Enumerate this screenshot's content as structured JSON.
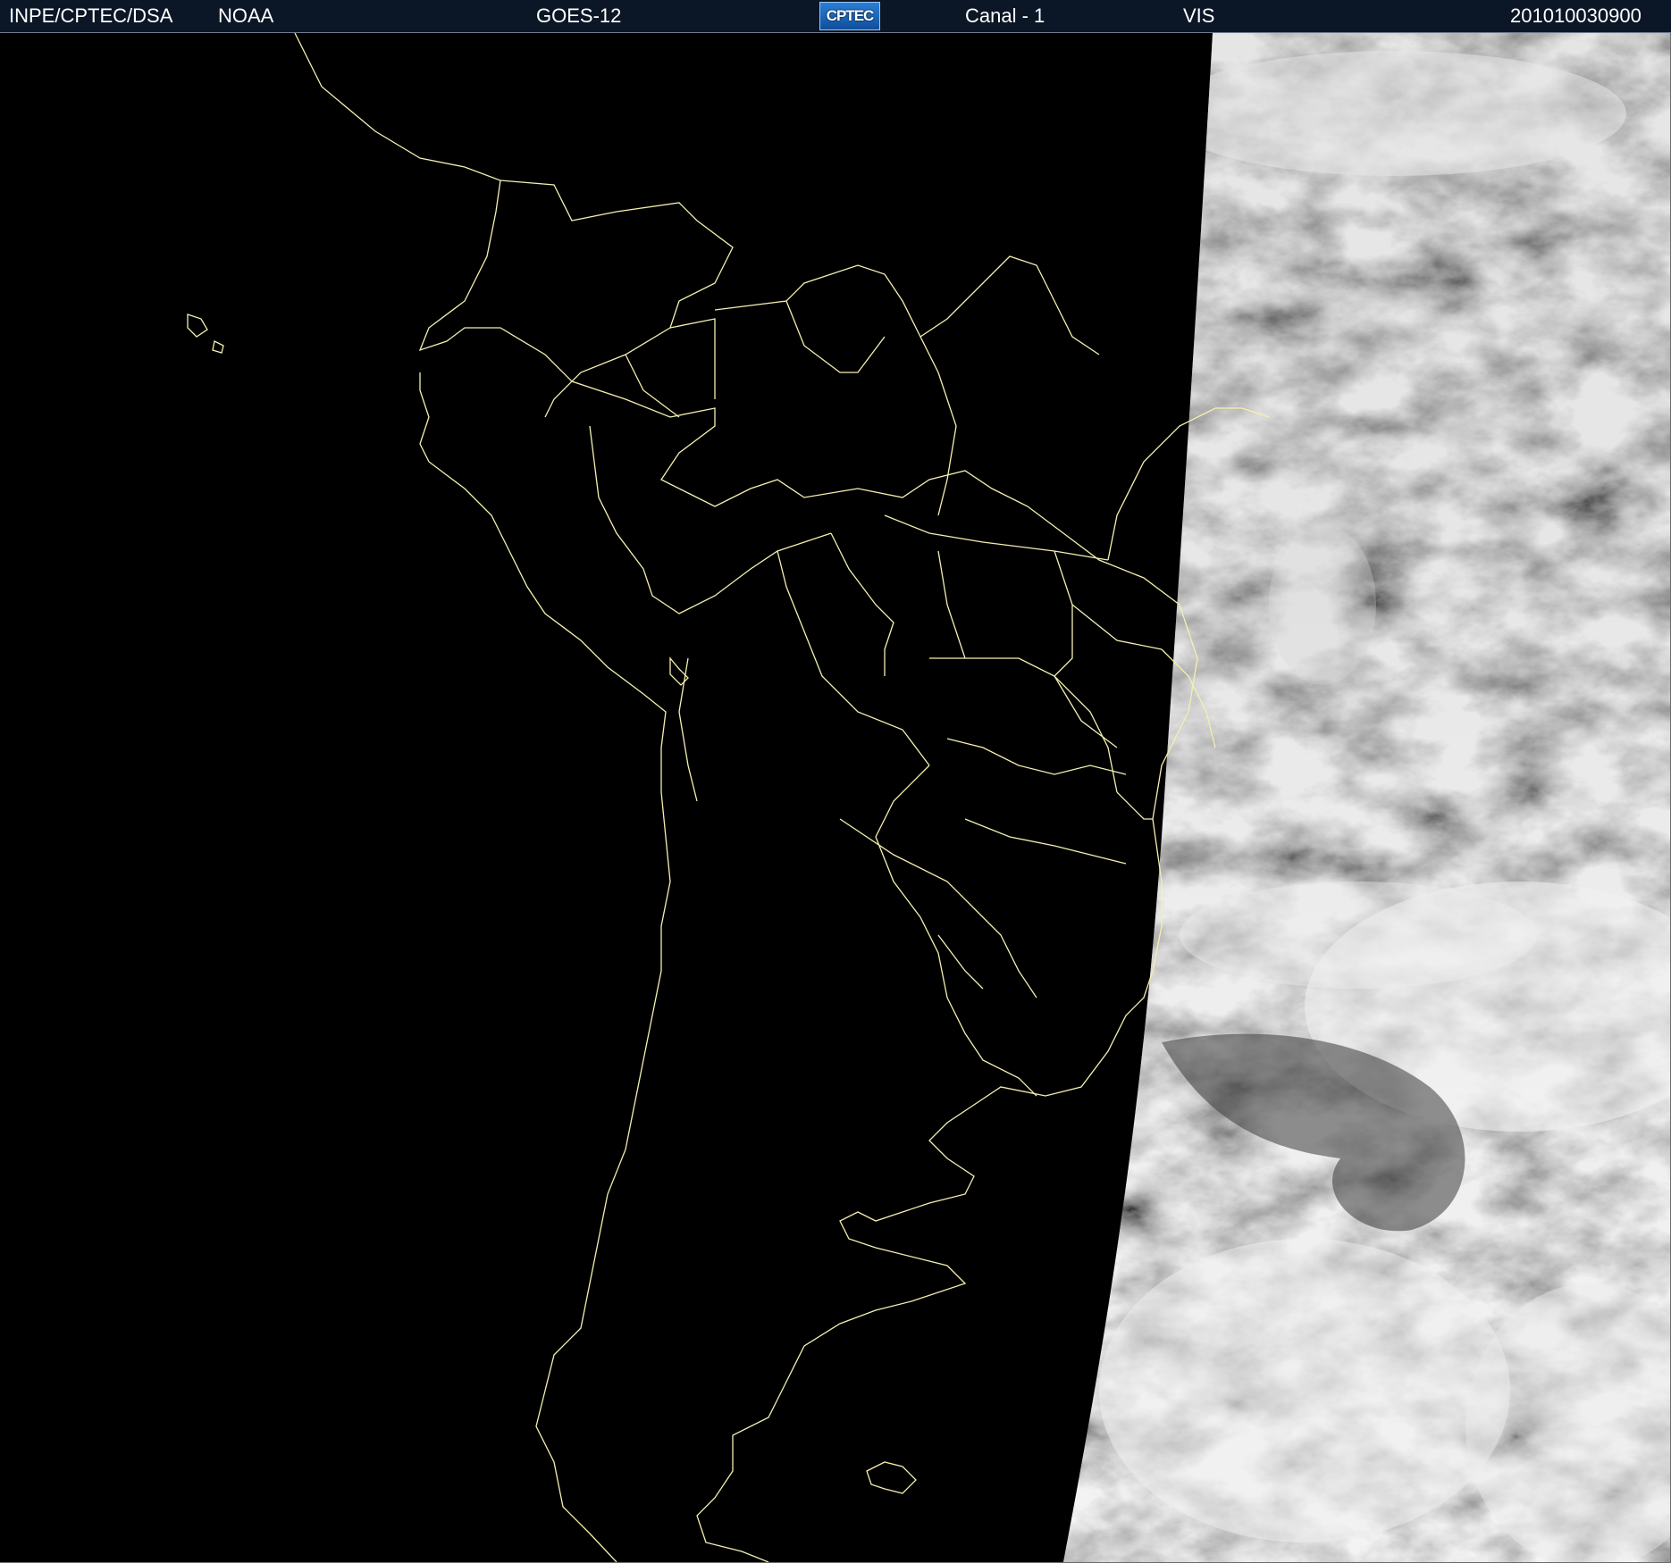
{
  "header": {
    "institution": "INPE/CPTEC/DSA",
    "agency": "NOAA",
    "satellite": "GOES-12",
    "logo_text": "CPTEC",
    "channel": "Canal - 1",
    "band": "VIS",
    "timestamp": "201010030900"
  },
  "map": {
    "boundary_color": "#f5f0b0",
    "night_color": "#000000",
    "cloud_color": "#d8d8d8",
    "ocean_color": "#4a4a4a"
  }
}
